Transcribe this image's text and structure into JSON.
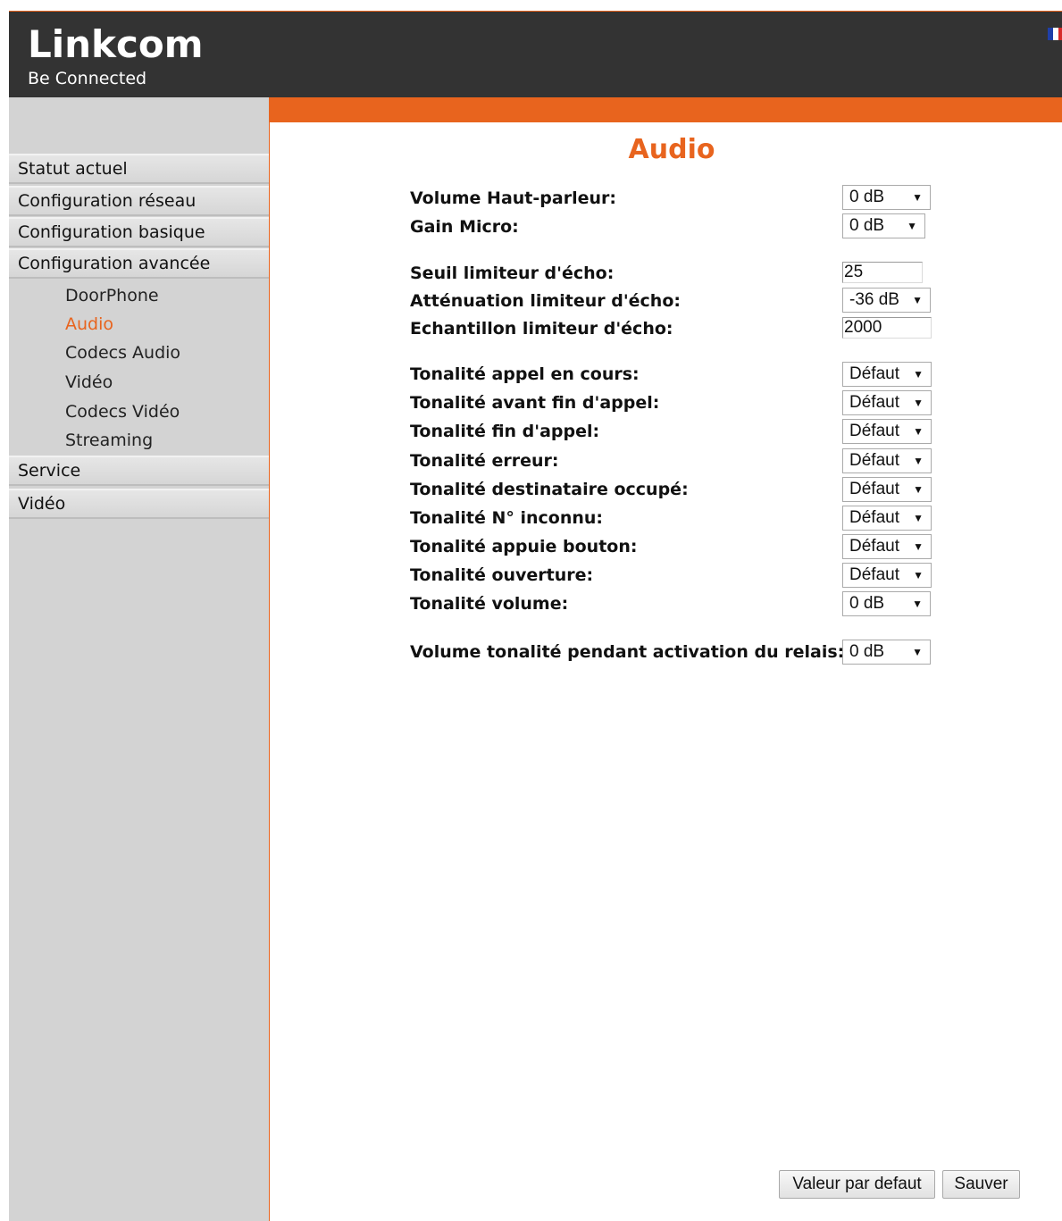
{
  "header": {
    "brand": "Linkcom",
    "tagline": "Be Connected",
    "language_icon": "french-flag-icon"
  },
  "sidebar": {
    "items": [
      {
        "label": "Statut actuel"
      },
      {
        "label": "Configuration réseau"
      },
      {
        "label": "Configuration basique"
      },
      {
        "label": "Configuration avancée"
      },
      {
        "label": "Service"
      },
      {
        "label": "Vidéo"
      }
    ],
    "subitems": [
      {
        "label": "DoorPhone",
        "active": false
      },
      {
        "label": "Audio",
        "active": true
      },
      {
        "label": "Codecs Audio",
        "active": false
      },
      {
        "label": "Vidéo",
        "active": false
      },
      {
        "label": "Codecs Vidéo",
        "active": false
      },
      {
        "label": "Streaming",
        "active": false
      }
    ]
  },
  "main": {
    "title": "Audio",
    "fields": [
      {
        "label": "Volume Haut-parleur:",
        "type": "select",
        "value": "0 dB"
      },
      {
        "label": "Gain Micro:",
        "type": "select",
        "value": "0 dB"
      },
      {
        "label": "Seuil limiteur d'écho:",
        "type": "text",
        "value": "25"
      },
      {
        "label": "Atténuation limiteur d'écho:",
        "type": "select",
        "value": "-36 dB"
      },
      {
        "label": "Echantillon limiteur d'écho:",
        "type": "text",
        "value": "2000"
      },
      {
        "label": "Tonalité appel en cours:",
        "type": "select",
        "value": "Défaut"
      },
      {
        "label": "Tonalité avant fin d'appel:",
        "type": "select",
        "value": "Défaut"
      },
      {
        "label": "Tonalité fin d'appel:",
        "type": "select",
        "value": "Défaut"
      },
      {
        "label": "Tonalité erreur:",
        "type": "select",
        "value": "Défaut"
      },
      {
        "label": "Tonalité destinataire occupé:",
        "type": "select",
        "value": "Défaut"
      },
      {
        "label": "Tonalité N° inconnu:",
        "type": "select",
        "value": "Défaut"
      },
      {
        "label": "Tonalité appuie bouton:",
        "type": "select",
        "value": "Défaut"
      },
      {
        "label": "Tonalité ouverture:",
        "type": "select",
        "value": "Défaut"
      },
      {
        "label": "Tonalité volume:",
        "type": "select",
        "value": "0 dB"
      },
      {
        "label": "Volume tonalité pendant activation du relais:",
        "type": "select",
        "value": "0 dB"
      }
    ],
    "buttons": {
      "default_label": "Valeur par defaut",
      "save_label": "Sauver"
    }
  },
  "colors": {
    "accent": "#e8641e",
    "header_bg": "#333333",
    "sidebar_bg": "#d3d3d3"
  }
}
